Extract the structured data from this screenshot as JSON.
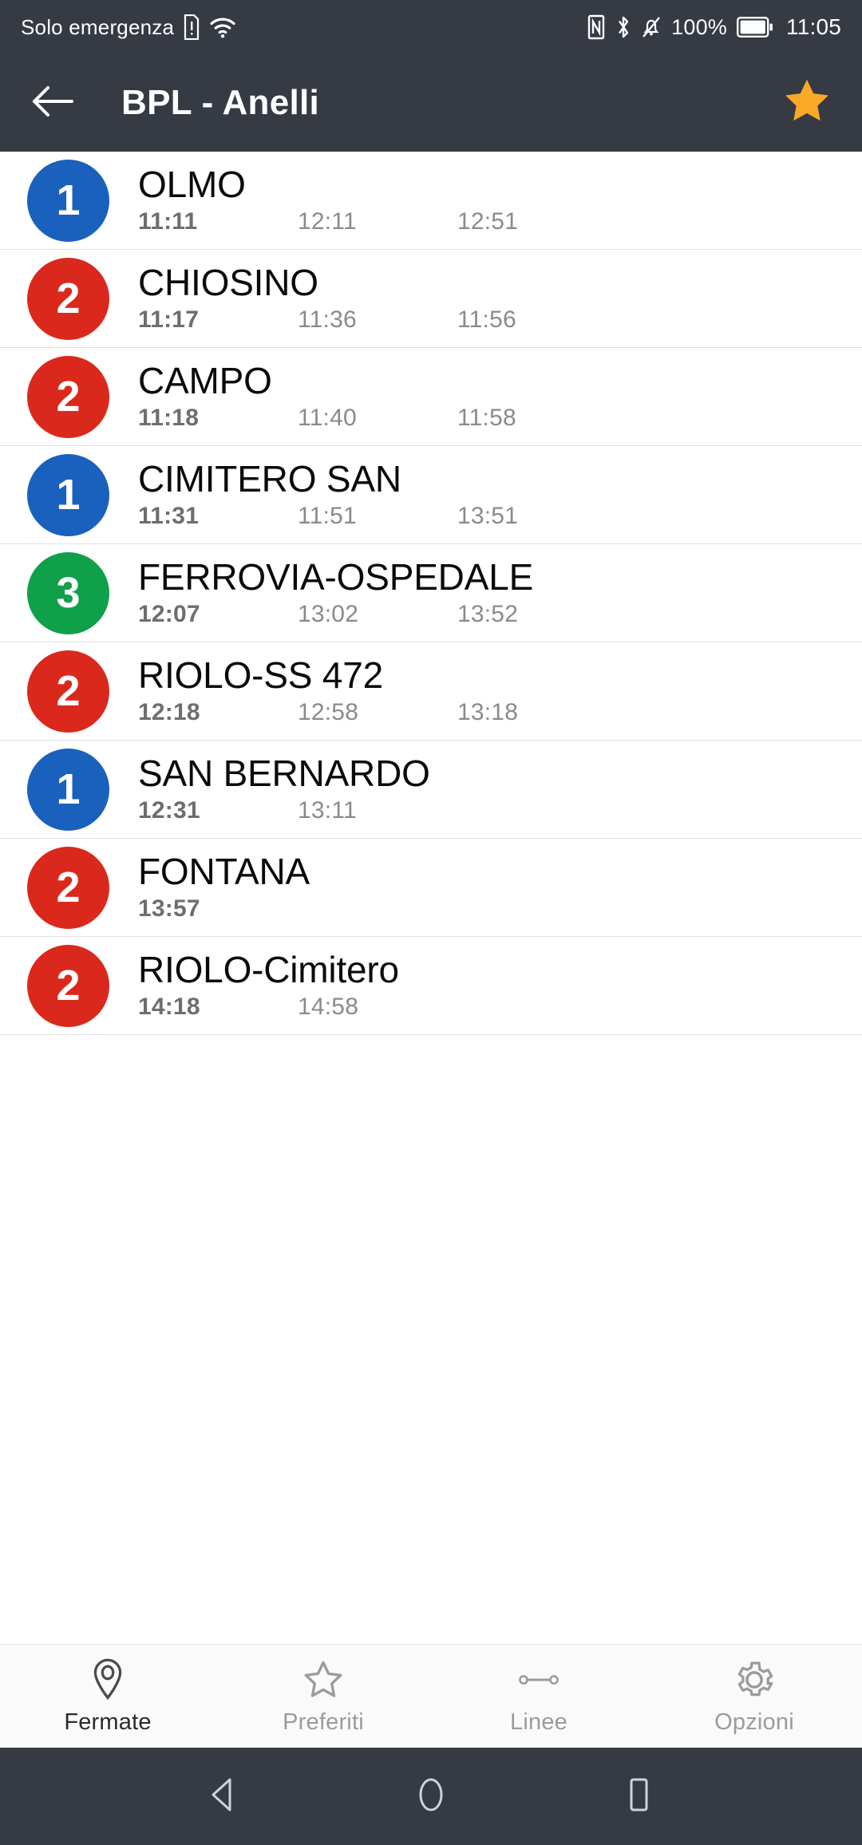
{
  "statusbar": {
    "carrier_text": "Solo emergenza",
    "sim_icon": "sim-alert-icon",
    "wifi_icon": "wifi-icon",
    "nfc_icon": "nfc-icon",
    "bluetooth_icon": "bluetooth-icon",
    "mute_icon": "bell-muted-icon",
    "battery_percent": "100%",
    "battery_icon": "battery-full-icon",
    "clock": "11:05",
    "background_color": "#353a43",
    "text_color": "#ffffff"
  },
  "appbar": {
    "back_icon": "arrow-left-icon",
    "title": "BPL - Anelli",
    "favorite_icon": "star-filled-icon",
    "favorite_color": "#f9a828",
    "background_color": "#353a43"
  },
  "colors": {
    "line_1": "#1a61bd",
    "line_2": "#da291c",
    "line_3": "#10a04a",
    "divider": "#e2e2e2",
    "time_default": "#8a8a8a",
    "time_first": "#6e6e6e"
  },
  "list": {
    "rows": [
      {
        "line": "1",
        "color": "#1a61bd",
        "stop": "OLMO",
        "times": [
          "11:11",
          "12:11",
          "12:51"
        ]
      },
      {
        "line": "2",
        "color": "#da291c",
        "stop": "CHIOSINO",
        "times": [
          "11:17",
          "11:36",
          "11:56"
        ]
      },
      {
        "line": "2",
        "color": "#da291c",
        "stop": "CAMPO",
        "times": [
          "11:18",
          "11:40",
          "11:58"
        ]
      },
      {
        "line": "1",
        "color": "#1a61bd",
        "stop": "CIMITERO SAN",
        "times": [
          "11:31",
          "11:51",
          "13:51"
        ]
      },
      {
        "line": "3",
        "color": "#10a04a",
        "stop": "FERROVIA-OSPEDALE",
        "times": [
          "12:07",
          "13:02",
          "13:52"
        ]
      },
      {
        "line": "2",
        "color": "#da291c",
        "stop": "RIOLO-SS 472",
        "times": [
          "12:18",
          "12:58",
          "13:18"
        ]
      },
      {
        "line": "1",
        "color": "#1a61bd",
        "stop": "SAN BERNARDO",
        "times": [
          "12:31",
          "13:11"
        ]
      },
      {
        "line": "2",
        "color": "#da291c",
        "stop": "FONTANA",
        "times": [
          "13:57"
        ]
      },
      {
        "line": "2",
        "color": "#da291c",
        "stop": "RIOLO-Cimitero",
        "times": [
          "14:18",
          "14:58"
        ]
      }
    ]
  },
  "bottomnav": {
    "items": [
      {
        "label": "Fermate",
        "icon": "map-pin-icon",
        "active": true
      },
      {
        "label": "Preferiti",
        "icon": "star-outline-icon",
        "active": false
      },
      {
        "label": "Linee",
        "icon": "route-line-icon",
        "active": false
      },
      {
        "label": "Opzioni",
        "icon": "gear-icon",
        "active": false
      }
    ]
  },
  "androidnav": {
    "back_icon": "triangle-back-icon",
    "home_icon": "circle-home-icon",
    "recents_icon": "square-recents-icon",
    "background_color": "#353a43"
  }
}
